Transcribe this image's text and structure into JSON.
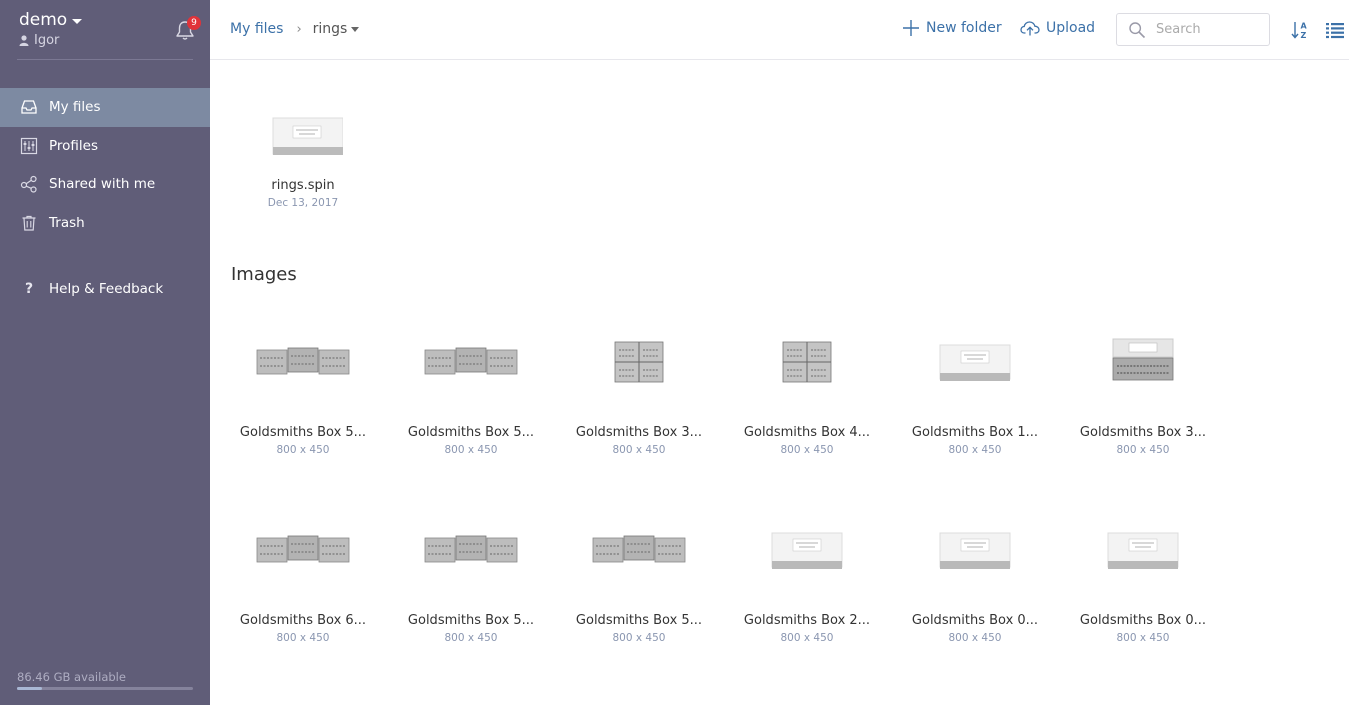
{
  "account": {
    "name": "demo",
    "user": "Igor",
    "notifications": "9"
  },
  "nav": {
    "items": [
      {
        "label": "My files",
        "icon": "inbox-icon",
        "active": true
      },
      {
        "label": "Profiles",
        "icon": "sliders-icon",
        "active": false
      },
      {
        "label": "Shared with me",
        "icon": "share-icon",
        "active": false
      },
      {
        "label": "Trash",
        "icon": "trash-icon",
        "active": false
      }
    ],
    "help": "Help & Feedback"
  },
  "storage": {
    "label": "86.46 GB available",
    "fraction": 0.14
  },
  "breadcrumb": {
    "root": "My files",
    "current": "rings"
  },
  "toolbar": {
    "new_folder": "New folder",
    "upload": "Upload",
    "search_placeholder": "Search"
  },
  "spin_file": {
    "name": "rings.spin",
    "date": "Dec 13, 2017"
  },
  "images_section": {
    "title": "Images"
  },
  "images": [
    {
      "name": "Goldsmiths Box 5...",
      "size": "800 x 450",
      "thumb": "trio"
    },
    {
      "name": "Goldsmiths Box 5...",
      "size": "800 x 450",
      "thumb": "trio"
    },
    {
      "name": "Goldsmiths Box 3...",
      "size": "800 x 450",
      "thumb": "grid"
    },
    {
      "name": "Goldsmiths Box 4...",
      "size": "800 x 450",
      "thumb": "grid"
    },
    {
      "name": "Goldsmiths Box 1...",
      "size": "800 x 450",
      "thumb": "closed"
    },
    {
      "name": "Goldsmiths Box 3...",
      "size": "800 x 450",
      "thumb": "open"
    },
    {
      "name": "Goldsmiths Box 6...",
      "size": "800 x 450",
      "thumb": "trio"
    },
    {
      "name": "Goldsmiths Box 5...",
      "size": "800 x 450",
      "thumb": "trio"
    },
    {
      "name": "Goldsmiths Box 5...",
      "size": "800 x 450",
      "thumb": "trio"
    },
    {
      "name": "Goldsmiths Box 2...",
      "size": "800 x 450",
      "thumb": "closed"
    },
    {
      "name": "Goldsmiths Box 0...",
      "size": "800 x 450",
      "thumb": "closed"
    },
    {
      "name": "Goldsmiths Box 0...",
      "size": "800 x 450",
      "thumb": "closed"
    }
  ],
  "colors": {
    "sidebar": "#605d78",
    "active": "#7d8aa2",
    "accent": "#3c71a8",
    "badge": "#e0333a"
  }
}
